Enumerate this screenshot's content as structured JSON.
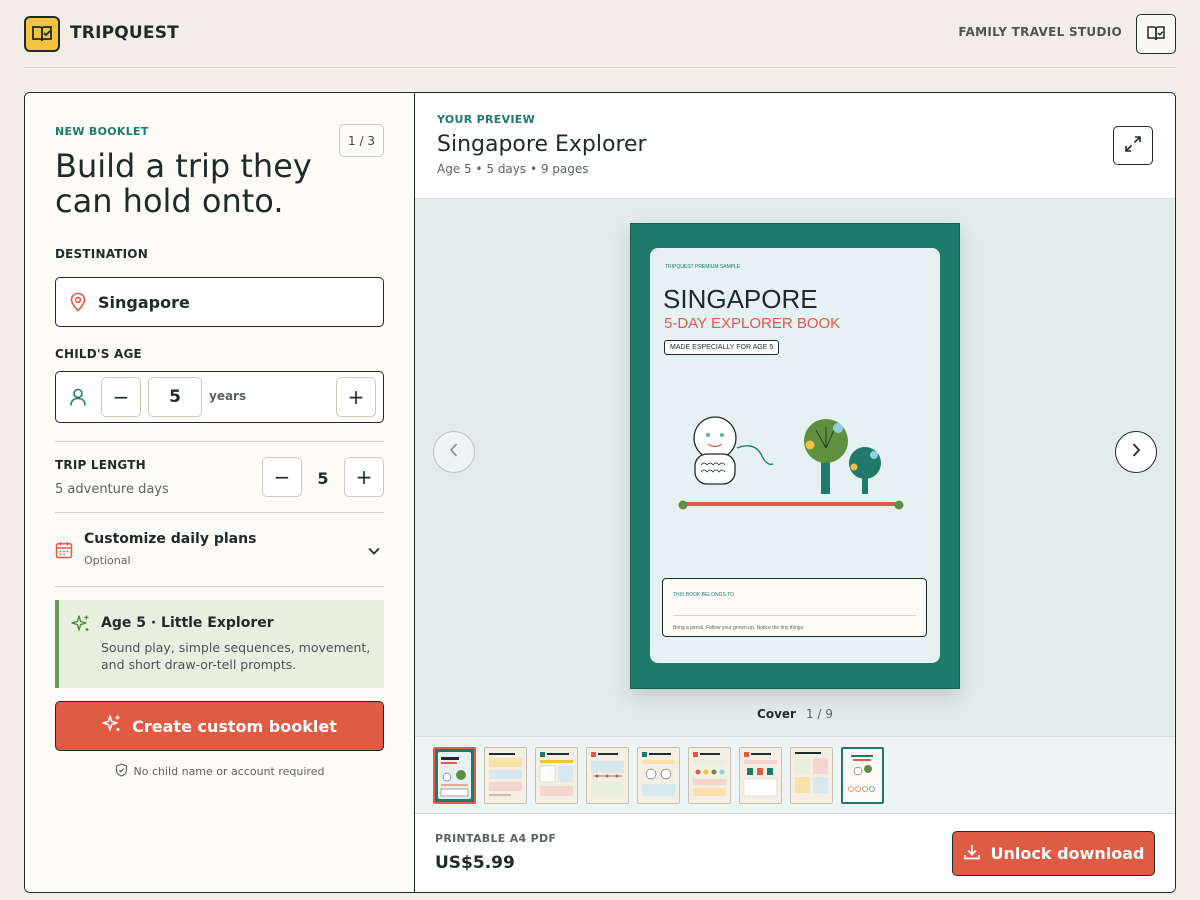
{
  "app": {
    "brand": "TRIPQUEST",
    "studio_label": "FAMILY TRAVEL STUDIO",
    "icons": [
      "book-check-icon",
      "book-icon"
    ]
  },
  "builder": {
    "eyebrow": "NEW BOOKLET",
    "step": "1 / 3",
    "headline": "Build a trip they can hold onto.",
    "destination": {
      "label": "DESTINATION",
      "value": "Singapore",
      "icon": "map-pin-icon"
    },
    "age": {
      "label": "CHILD'S AGE",
      "value": "5",
      "unit": "years",
      "minus": "−",
      "plus": "+"
    },
    "trip_length": {
      "label": "TRIP LENGTH",
      "sub": "5 adventure days",
      "value": "5",
      "minus": "−",
      "plus": "+"
    },
    "customize": {
      "title": "Customize daily plans",
      "sub": "Optional"
    },
    "tip": {
      "title": "Age 5 · Little Explorer",
      "body": "Sound play, simple sequences, movement, and short draw-or-tell prompts."
    },
    "create_label": "Create custom booklet",
    "privacy_note": "No child name or account required"
  },
  "preview": {
    "eyebrow": "YOUR PREVIEW",
    "title": "Singapore Explorer",
    "meta": "Age 5 • 5 days • 9 pages",
    "book": {
      "small_label": "TRIPQUEST PREMIUM SAMPLE",
      "title": "SINGAPORE",
      "subtitle": "5-DAY EXPLORER BOOK",
      "tag": "MADE ESPECIALLY FOR AGE 5",
      "belongs_label": "THIS BOOK BELONGS TO",
      "belongs_note": "Bring a pencil. Follow your grown-up. Notice the tiny things."
    },
    "page_name": "Cover",
    "page_count": "1 / 9",
    "thumbnails": 9,
    "selected_thumbnail": 1
  },
  "purchase": {
    "label": "PRINTABLE A4 PDF",
    "price": "US$5.99",
    "button": "Unlock download"
  },
  "colors": {
    "accent": "#df5b44",
    "teal": "#1f7a6b",
    "brand_yellow": "#f3c23e",
    "background": "#f2eee7"
  }
}
